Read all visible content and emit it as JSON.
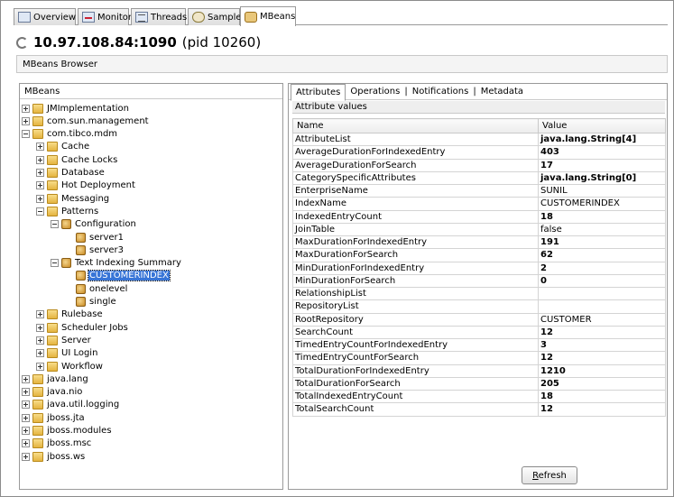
{
  "tabs": [
    {
      "label": "Overview",
      "icon": "overview-icon"
    },
    {
      "label": "Monitor",
      "icon": "monitor-icon"
    },
    {
      "label": "Threads",
      "icon": "threads-icon"
    },
    {
      "label": "Sampler",
      "icon": "sampler-icon"
    },
    {
      "label": "MBeans",
      "icon": "mbeans-icon",
      "active": true
    }
  ],
  "header": {
    "host": "10.97.108.84:1090",
    "pid": "(pid 10260)"
  },
  "subheader": "MBeans Browser",
  "tree": {
    "title": "MBeans",
    "nodes": [
      {
        "label": "JMImplementation",
        "type": "folder",
        "expander": "plus"
      },
      {
        "label": "com.sun.management",
        "type": "folder",
        "expander": "plus"
      },
      {
        "label": "com.tibco.mdm",
        "type": "folder",
        "expander": "minus"
      },
      {
        "label": "Cache",
        "type": "folder",
        "expander": "plus"
      },
      {
        "label": "Cache Locks",
        "type": "folder",
        "expander": "plus"
      },
      {
        "label": "Database",
        "type": "folder",
        "expander": "plus"
      },
      {
        "label": "Hot Deployment",
        "type": "folder",
        "expander": "plus"
      },
      {
        "label": "Messaging",
        "type": "folder",
        "expander": "plus"
      },
      {
        "label": "Patterns",
        "type": "folder",
        "expander": "minus"
      },
      {
        "label": "Configuration",
        "type": "bean",
        "expander": "minus"
      },
      {
        "label": "server1",
        "type": "bean"
      },
      {
        "label": "server3",
        "type": "bean"
      },
      {
        "label": "Text Indexing Summary",
        "type": "bean",
        "expander": "minus"
      },
      {
        "label": "CUSTOMERINDEX",
        "type": "bean",
        "selected": true
      },
      {
        "label": "onelevel",
        "type": "bean"
      },
      {
        "label": "single",
        "type": "bean"
      },
      {
        "label": "Rulebase",
        "type": "folder",
        "expander": "plus"
      },
      {
        "label": "Scheduler Jobs",
        "type": "folder",
        "expander": "plus"
      },
      {
        "label": "Server",
        "type": "folder",
        "expander": "plus"
      },
      {
        "label": "UI Login",
        "type": "folder",
        "expander": "plus"
      },
      {
        "label": "Workflow",
        "type": "folder",
        "expander": "plus"
      },
      {
        "label": "java.lang",
        "type": "folder",
        "expander": "plus"
      },
      {
        "label": "java.nio",
        "type": "folder",
        "expander": "plus"
      },
      {
        "label": "java.util.logging",
        "type": "folder",
        "expander": "plus"
      },
      {
        "label": "jboss.jta",
        "type": "folder",
        "expander": "plus"
      },
      {
        "label": "jboss.modules",
        "type": "folder",
        "expander": "plus"
      },
      {
        "label": "jboss.msc",
        "type": "folder",
        "expander": "plus"
      },
      {
        "label": "jboss.ws",
        "type": "folder",
        "expander": "plus"
      }
    ]
  },
  "subtabs": [
    "Attributes",
    "Operations",
    "Notifications",
    "Metadata"
  ],
  "attributes": {
    "group_label": "Attribute values",
    "col_name": "Name",
    "col_value": "Value",
    "rows": [
      {
        "name": "AttributeList",
        "value": "java.lang.String[4]",
        "bold": true
      },
      {
        "name": "AverageDurationForIndexedEntry",
        "value": "403",
        "bold": true
      },
      {
        "name": "AverageDurationForSearch",
        "value": "17",
        "bold": true
      },
      {
        "name": "CategorySpecificAttributes",
        "value": "java.lang.String[0]",
        "bold": true
      },
      {
        "name": "EnterpriseName",
        "value": "SUNIL",
        "bold": false
      },
      {
        "name": "IndexName",
        "value": "CUSTOMERINDEX",
        "bold": false
      },
      {
        "name": "IndexedEntryCount",
        "value": "18",
        "bold": true
      },
      {
        "name": "JoinTable",
        "value": "false",
        "bold": false
      },
      {
        "name": "MaxDurationForIndexedEntry",
        "value": "191",
        "bold": true
      },
      {
        "name": "MaxDurationForSearch",
        "value": "62",
        "bold": true
      },
      {
        "name": "MinDurationForIndexedEntry",
        "value": "2",
        "bold": true
      },
      {
        "name": "MinDurationForSearch",
        "value": "0",
        "bold": true
      },
      {
        "name": "RelationshipList",
        "value": "",
        "bold": false
      },
      {
        "name": "RepositoryList",
        "value": "",
        "bold": false
      },
      {
        "name": "RootRepository",
        "value": "CUSTOMER",
        "bold": false
      },
      {
        "name": "SearchCount",
        "value": "12",
        "bold": true
      },
      {
        "name": "TimedEntryCountForIndexedEntry",
        "value": "3",
        "bold": true
      },
      {
        "name": "TimedEntryCountForSearch",
        "value": "12",
        "bold": true
      },
      {
        "name": "TotalDurationForIndexedEntry",
        "value": "1210",
        "bold": true
      },
      {
        "name": "TotalDurationForSearch",
        "value": "205",
        "bold": true
      },
      {
        "name": "TotalIndexedEntryCount",
        "value": "18",
        "bold": true
      },
      {
        "name": "TotalSearchCount",
        "value": "12",
        "bold": true
      }
    ]
  },
  "refresh": {
    "mnemonic": "R",
    "rest": "efresh"
  }
}
